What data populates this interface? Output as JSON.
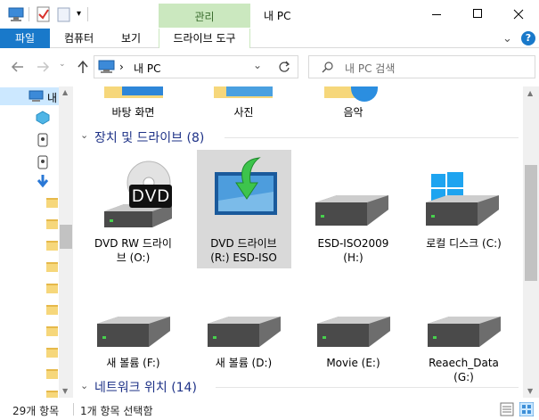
{
  "window": {
    "title": "내 PC",
    "manage_label": "관리",
    "help_glyph": "?",
    "chevron_glyph": "⌄"
  },
  "ribbon": {
    "tabs": [
      "파일",
      "컴퓨터",
      "보기"
    ],
    "drive_tools": "드라이브 도구"
  },
  "address": {
    "path": "내 PC",
    "separator": "›",
    "search_placeholder": "내 PC 검색"
  },
  "nav": {
    "selected_label": "내"
  },
  "folders": {
    "items": [
      "바탕 화면",
      "사진",
      "음악"
    ]
  },
  "devices": {
    "header": "장치 및 드라이브",
    "count": "(8)",
    "dvd_text": "DVD",
    "items": [
      {
        "line1": "DVD RW 드라이",
        "line2": "브 (O:)"
      },
      {
        "line1": "DVD 드라이브",
        "line2": "(R:) ESD-ISO"
      },
      {
        "line1": "ESD-ISO2009",
        "line2": "(H:)"
      },
      {
        "line1": "로컬 디스크 (C:)",
        "line2": ""
      },
      {
        "line1": "새 볼륨 (F:)",
        "line2": ""
      },
      {
        "line1": "새 볼륨 (D:)",
        "line2": ""
      },
      {
        "line1": "Movie (E:)",
        "line2": ""
      },
      {
        "line1": "Reaech_Data (G:)",
        "line2": ""
      }
    ]
  },
  "network": {
    "header": "네트워크 위치",
    "count": "(14)"
  },
  "status": {
    "item_count": "29개 항목",
    "selected": "1개 항목 선택함"
  },
  "colors": {
    "accent": "#1979ca",
    "manage_tab": "#cbe8bf",
    "selection": "#d9d9d9",
    "nav_selection": "#cce8ff",
    "header_text": "#1e3287"
  }
}
